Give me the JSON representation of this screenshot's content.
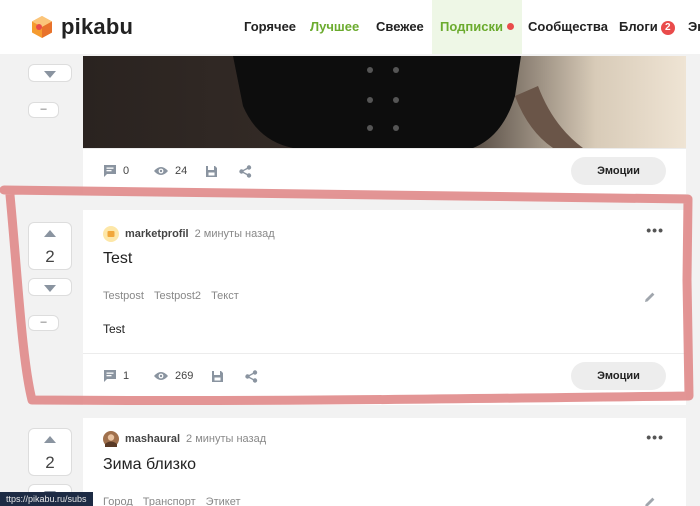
{
  "header": {
    "logo_text": "pikabu",
    "nav": [
      {
        "label": "Горячее"
      },
      {
        "label": "Лучшее"
      },
      {
        "label": "Свежее"
      },
      {
        "label": "Подписки"
      },
      {
        "label": "Сообщества"
      },
      {
        "label": "Блоги",
        "badge": "2"
      },
      {
        "label": "Эк"
      }
    ]
  },
  "posts": [
    {
      "rating_dash": "–",
      "comments": "0",
      "views": "24",
      "emotions_label": "Эмоции"
    },
    {
      "rating": "2",
      "rating_dash": "–",
      "author": "marketprofil",
      "time": "2 минуты назад",
      "title": "Test",
      "tags": [
        "Testpost",
        "Testpost2",
        "Текст"
      ],
      "body": "Test",
      "comments": "1",
      "views": "269",
      "emotions_label": "Эмоции"
    },
    {
      "rating": "2",
      "author": "mashaural",
      "time": "2 минуты назад",
      "title": "Зима близко",
      "tags": [
        "Город",
        "Транспорт",
        "Этикет"
      ]
    }
  ],
  "status_url": "ttps://pikabu.ru/subs",
  "colors": {
    "accent_green": "#6bab2e",
    "badge_red": "#e94b4b",
    "annotation": "#e08a8a"
  }
}
